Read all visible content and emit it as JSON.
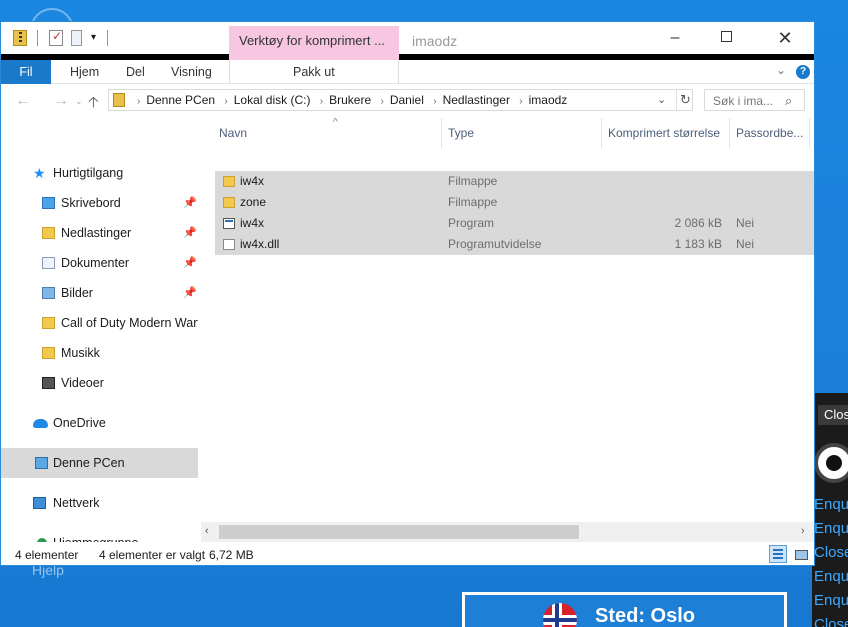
{
  "window": {
    "title": "imaodz",
    "context_tab": "Verktøy for komprimert ...",
    "controls": {
      "minimize": "–",
      "close": "✕"
    }
  },
  "ribbon": {
    "tabs": [
      "Fil",
      "Hjem",
      "Del",
      "Visning"
    ],
    "context_action": "Pakk ut",
    "help": "?"
  },
  "address": {
    "crumbs": [
      "Denne PCen",
      "Lokal disk (C:)",
      "Brukere",
      "Daniel",
      "Nedlastinger",
      "imaodz"
    ],
    "separator": "›",
    "search_placeholder": "Søk i ima..."
  },
  "nav": {
    "items": [
      {
        "label": "Hurtigtilgang",
        "icon": "star-icon",
        "pinned": false
      },
      {
        "label": "Skrivebord",
        "icon": "desktop-folder-icon",
        "pinned": true
      },
      {
        "label": "Nedlastinger",
        "icon": "downloads-folder-icon",
        "pinned": true
      },
      {
        "label": "Dokumenter",
        "icon": "documents-folder-icon",
        "pinned": true
      },
      {
        "label": "Bilder",
        "icon": "pictures-folder-icon",
        "pinned": true
      },
      {
        "label": "Call of Duty Modern Warfa",
        "icon": "folder-icon",
        "pinned": false
      },
      {
        "label": "Musikk",
        "icon": "music-folder-icon",
        "pinned": false
      },
      {
        "label": "Videoer",
        "icon": "videos-folder-icon",
        "pinned": false
      },
      {
        "label": "OneDrive",
        "icon": "onedrive-icon",
        "pinned": false
      },
      {
        "label": "Denne PCen",
        "icon": "this-pc-icon",
        "pinned": false,
        "selected": true
      },
      {
        "label": "Nettverk",
        "icon": "network-icon",
        "pinned": false
      },
      {
        "label": "Hjemmegruppe",
        "icon": "homegroup-icon",
        "pinned": false
      }
    ]
  },
  "columns": [
    "Navn",
    "Type",
    "Komprimert størrelse",
    "Passordbe..."
  ],
  "files": [
    {
      "name": "iw4x",
      "type": "Filmappe",
      "size": "",
      "password": "",
      "icon": "folder-icon"
    },
    {
      "name": "zone",
      "type": "Filmappe",
      "size": "",
      "password": "",
      "icon": "folder-icon"
    },
    {
      "name": "iw4x",
      "type": "Program",
      "size": "2 086 kB",
      "password": "Nei",
      "icon": "exe-icon"
    },
    {
      "name": "iw4x.dll",
      "type": "Programutvidelse",
      "size": "1 183 kB",
      "password": "Nei",
      "icon": "dll-icon"
    }
  ],
  "status": {
    "count": "4 elementer",
    "selected": "4 elementer er valgt",
    "size": "6,72 MB"
  },
  "background": {
    "side_text": "Hjelp",
    "dark_app_button": "Close",
    "dark_app_lines": [
      "Enqu",
      "Enqu",
      "Close",
      "Enqu",
      "Enqu",
      "Close"
    ],
    "location": "Sted: Oslo"
  },
  "colors": {
    "accent": "#1979ca",
    "context_tab": "#f7c6e0",
    "selection": "#d9d9d9",
    "desktop": "#1b7fd8"
  }
}
